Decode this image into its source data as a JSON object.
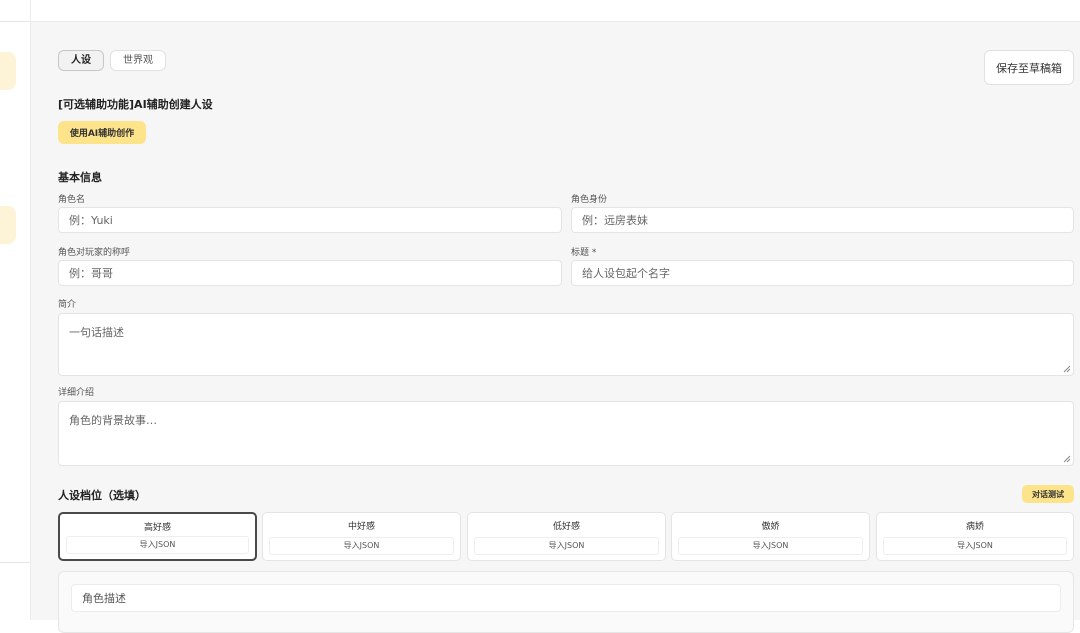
{
  "tabs": [
    {
      "label": "人设",
      "active": true
    },
    {
      "label": "世界观",
      "active": false
    }
  ],
  "save_button": "保存至草稿箱",
  "ai_section": {
    "title": "[可选辅助功能]AI辅助创建人设",
    "button": "使用AI辅助创作"
  },
  "basic_info": {
    "title": "基本信息",
    "role_name": {
      "label": "角色名",
      "placeholder": "例：Yuki"
    },
    "role_identity": {
      "label": "角色身份",
      "placeholder": "例：远房表妹"
    },
    "player_address": {
      "label": "角色对玩家的称呼",
      "placeholder": "例：哥哥"
    },
    "title_field": {
      "label": "标题 *",
      "placeholder": "给人设包起个名字"
    },
    "summary": {
      "label": "简介",
      "placeholder": "一句话描述"
    },
    "detail": {
      "label": "详细介绍",
      "placeholder": "角色的背景故事…"
    }
  },
  "persona_tiers": {
    "title": "人设档位（选填）",
    "test_button": "对话测试",
    "items": [
      {
        "name": "高好感",
        "import": "导入JSON",
        "active": true
      },
      {
        "name": "中好感",
        "import": "导入JSON",
        "active": false
      },
      {
        "name": "低好感",
        "import": "导入JSON",
        "active": false
      },
      {
        "name": "傲娇",
        "import": "导入JSON",
        "active": false
      },
      {
        "name": "病娇",
        "import": "导入JSON",
        "active": false
      }
    ]
  },
  "role_description": {
    "placeholder": "角色描述"
  },
  "colors": {
    "accent": "#fde38a",
    "accent_soft": "#fdf3d6",
    "background": "#f6f6f6"
  }
}
